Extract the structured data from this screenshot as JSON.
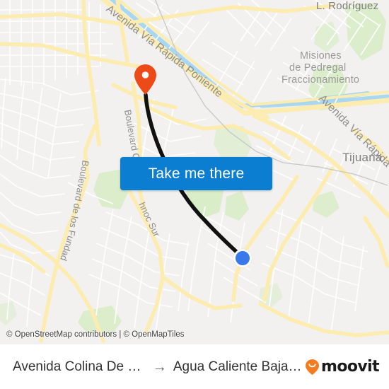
{
  "map": {
    "attribution": "© OpenStreetMap contributors | © OpenMapTiles",
    "labels": [
      {
        "text": "Avenida Vía Rápida Poniente",
        "name": "map-label-avenida-via-rapida-poniente"
      },
      {
        "text": "L. Rodríguez",
        "name": "map-label-l-rodriguez"
      },
      {
        "text": "Misiones",
        "name": "map-label-misiones"
      },
      {
        "text": "de Pedregal",
        "name": "map-label-de-pedregal"
      },
      {
        "text": "Fraccionamiento",
        "name": "map-label-fraccionamiento"
      },
      {
        "text": "Avenida Vía Rápida Po",
        "name": "map-label-avenida-via-rapida-po"
      },
      {
        "text": "Tijuana",
        "name": "map-label-tijuana"
      },
      {
        "text": "Boulevard C",
        "name": "map-label-boulevard-c"
      },
      {
        "text": "hnoc Sur",
        "name": "map-label-hnoc-sur"
      },
      {
        "text": "Boulevard de los Fundadores",
        "name": "map-label-boulevard-de-los-fundadores"
      }
    ],
    "colors": {
      "land": "#f2f1ef",
      "road_minor": "#ffffff",
      "road_major": "#fcecb0",
      "park": "#d8ecc6",
      "water": "#a8d7ef",
      "route_line": "#111111",
      "origin_pin": "#ec4a17",
      "destination_dot": "#3a79ec"
    }
  },
  "overlay": {
    "take_me_there_label": "Take me there"
  },
  "bottom_bar": {
    "origin": "Avenida Colina De Las V...",
    "arrow": "→",
    "destination": "Agua Caliente Baja Calif...",
    "brand": "moovit"
  }
}
